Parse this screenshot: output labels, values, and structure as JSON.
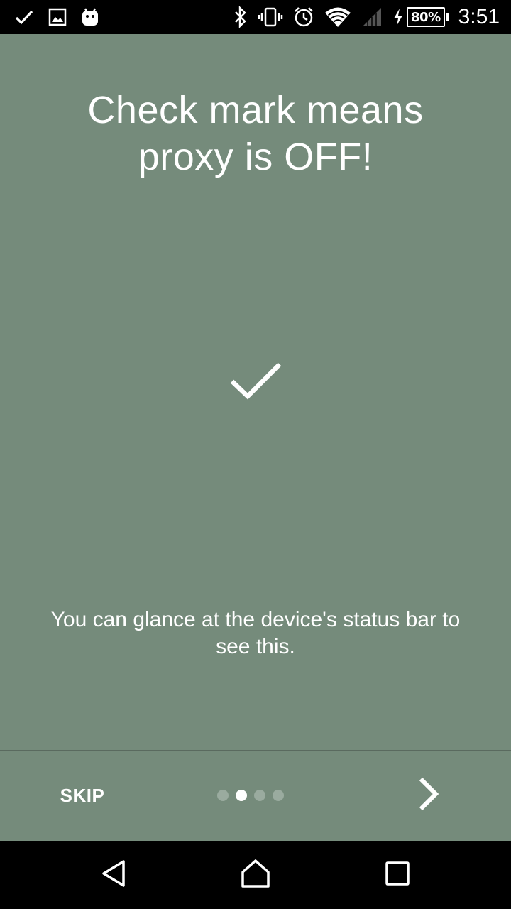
{
  "statusbar": {
    "left_icons": [
      "check-icon",
      "image-icon",
      "android-icon"
    ],
    "right_icons": [
      "bluetooth-icon",
      "vibrate-icon",
      "alarm-icon",
      "wifi-icon",
      "cell-signal-icon",
      "charging-icon"
    ],
    "battery_percent": "80%",
    "battery_level": 0.8,
    "time": "3:51"
  },
  "slide": {
    "title": "Check mark means\nproxy is OFF!",
    "illustration_icon": "checkmark-icon",
    "description": "You can glance at the device's status bar to\nsee this."
  },
  "footer": {
    "skip_label": "SKIP",
    "page_indicator": {
      "total": 4,
      "current": 2
    },
    "next_icon": "chevron-right-icon"
  },
  "navbar": {
    "icons": [
      "back-icon",
      "home-icon",
      "recents-icon"
    ]
  },
  "colors": {
    "background": "#758b7b",
    "bars": "#000000",
    "text": "#ffffff",
    "dot_inactive": "#9aab9f",
    "dot_active": "#ffffff"
  }
}
